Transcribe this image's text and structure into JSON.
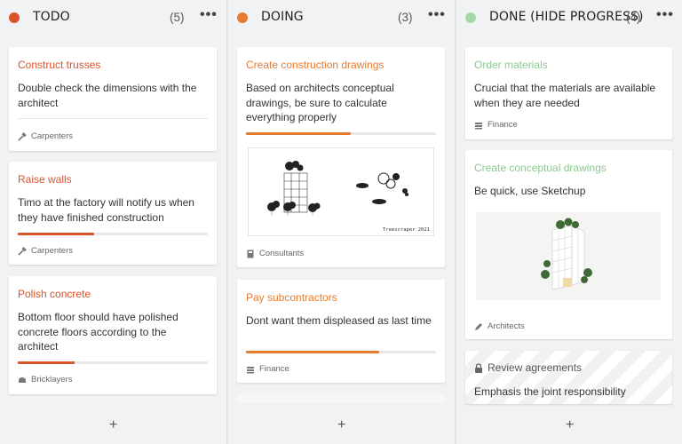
{
  "columns": [
    {
      "title": "TODO",
      "count": "(5)",
      "menu": "•••",
      "color": "#d9532b",
      "add_label": "+",
      "cards": [
        {
          "title": "Construct trusses",
          "description": "Double check the dimensions with the architect",
          "progress": 0,
          "tag": "Carpenters",
          "tag_icon": "hammer-icon"
        },
        {
          "title": "Raise walls",
          "description": "Timo at the factory will notify us when they have finished construction",
          "progress": 0.4,
          "tag": "Carpenters",
          "tag_icon": "hammer-icon"
        },
        {
          "title": "Polish concrete",
          "description": "Bottom floor should have polished concrete floors according to the architect",
          "progress": 0.3,
          "tag": "Bricklayers",
          "tag_icon": "hard-hat-icon"
        }
      ]
    },
    {
      "title": "DOING",
      "count": "(3)",
      "menu": "•••",
      "color": "#e57b2e",
      "add_label": "+",
      "cards": [
        {
          "title": "Create construction drawings",
          "description": "Based on architects conceptual drawings, be sure to calculate everything properly",
          "progress": 0.55,
          "image_caption": "Treescraper 2021",
          "tag": "Consultants",
          "tag_icon": "badge-icon"
        },
        {
          "title": "Pay subcontractors",
          "description": "Dont want them displeased as last time",
          "progress": 0.7,
          "tag": "Finance",
          "tag_icon": "money-icon"
        }
      ]
    },
    {
      "title": "DONE (HIDE PROGRESS)",
      "count": "(4)",
      "menu": "•••",
      "color": "#a6d7a8",
      "add_label": "+",
      "cards": [
        {
          "title": "Order materials",
          "description": "Crucial that the materials are available when they are needed",
          "tag": "Finance",
          "tag_icon": "money-icon"
        },
        {
          "title": "Create conceptual drawings",
          "description": "Be quick, use Sketchup",
          "tag": "Architects",
          "tag_icon": "pencil-icon"
        },
        {
          "title": "Review agreements",
          "description": "Emphasis the joint responsibility",
          "title_icon": "lock-icon"
        }
      ]
    }
  ]
}
